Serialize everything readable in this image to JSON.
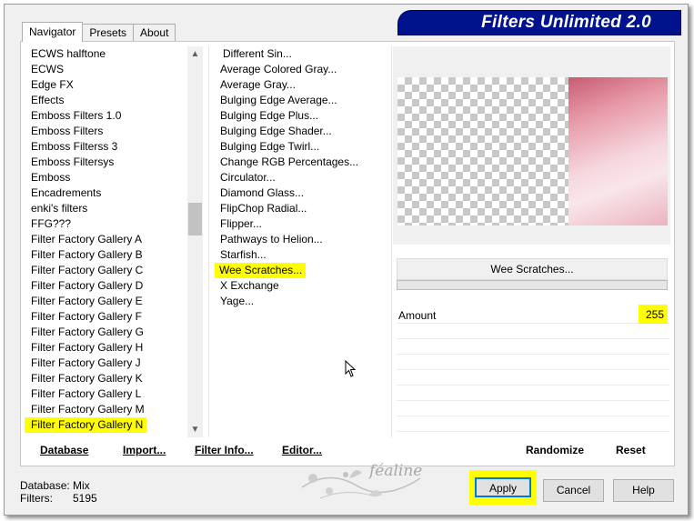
{
  "app": {
    "title": "Filters Unlimited 2.0"
  },
  "tabs": [
    {
      "label": "Navigator",
      "active": true
    },
    {
      "label": "Presets",
      "active": false
    },
    {
      "label": "About",
      "active": false
    }
  ],
  "categories": [
    "ECWS halftone",
    "ECWS",
    "Edge FX",
    "Effects",
    "Emboss Filters 1.0",
    "Emboss Filters",
    "Emboss Filterss 3",
    "Emboss Filtersys",
    "Emboss",
    "Encadrements",
    "enki's filters",
    "FFG???",
    "Filter Factory Gallery A",
    "Filter Factory Gallery B",
    "Filter Factory Gallery C",
    "Filter Factory Gallery D",
    "Filter Factory Gallery E",
    "Filter Factory Gallery F",
    "Filter Factory Gallery G",
    "Filter Factory Gallery H",
    "Filter Factory Gallery J",
    "Filter Factory Gallery K",
    "Filter Factory Gallery L",
    "Filter Factory Gallery M",
    "Filter Factory Gallery N"
  ],
  "selected_category": "Filter Factory Gallery N",
  "filters": [
    "Different Sin...",
    "Average Colored Gray...",
    "Average Gray...",
    "Bulging Edge Average...",
    "Bulging Edge Plus...",
    "Bulging Edge Shader...",
    "Bulging Edge Twirl...",
    "Change RGB Percentages...",
    "Circulator...",
    "Diamond Glass...",
    "FlipChop Radial...",
    "Flipper...",
    "Pathways to Helion...",
    "Starfish...",
    "Wee Scratches...",
    "X Exchange",
    "Yage..."
  ],
  "selected_filter": "Wee Scratches...",
  "preview": {
    "filter_button": "Wee Scratches..."
  },
  "parameters": [
    {
      "label": "Amount",
      "value": "255"
    }
  ],
  "bottom_links": {
    "database": "Database",
    "import": "Import...",
    "filter_info": "Filter Info...",
    "editor": "Editor...",
    "randomize": "Randomize",
    "reset": "Reset"
  },
  "status": {
    "database_label": "Database:",
    "database_value": "Mix",
    "filters_label": "Filters:",
    "filters_value": "5195"
  },
  "buttons": {
    "apply": "Apply",
    "cancel": "Cancel",
    "help": "Help"
  },
  "watermark": {
    "text": "féaline"
  },
  "colors": {
    "highlight": "#ffff00",
    "banner": "#00128c",
    "focus": "#0078d7"
  }
}
